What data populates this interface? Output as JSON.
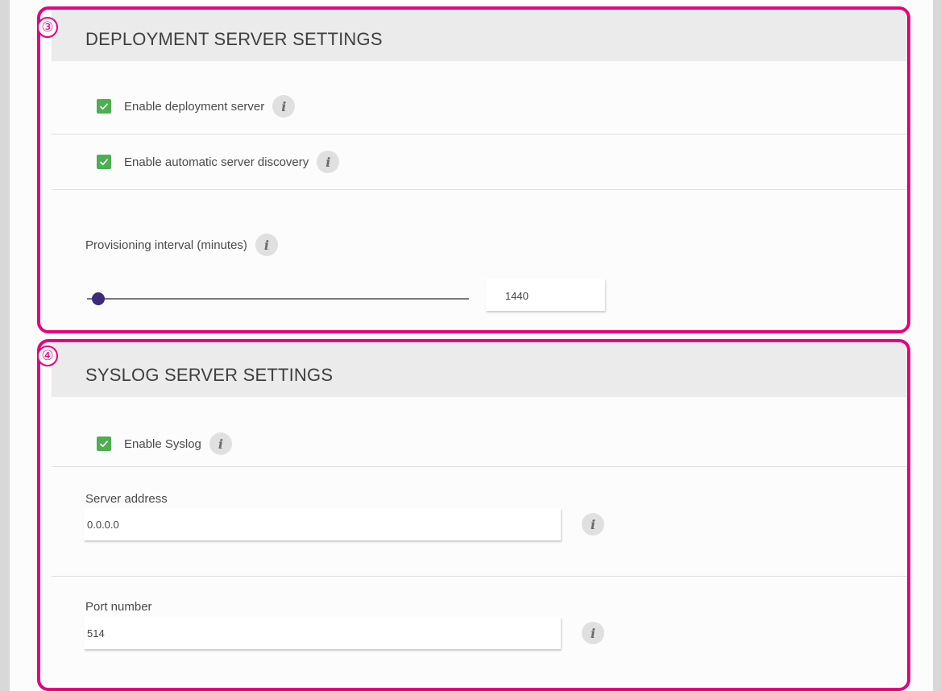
{
  "markers": {
    "deployment": "③",
    "syslog": "④"
  },
  "deployment": {
    "title": "DEPLOYMENT SERVER SETTINGS",
    "enable_server": {
      "label": "Enable deployment server",
      "checked": true
    },
    "auto_discovery": {
      "label": "Enable automatic server discovery",
      "checked": true
    },
    "provisioning": {
      "label": "Provisioning interval (minutes)",
      "value": "1440",
      "slider_fraction": 0.03
    }
  },
  "syslog": {
    "title": "SYSLOG SERVER SETTINGS",
    "enable_syslog": {
      "label": "Enable Syslog",
      "checked": true
    },
    "server_address": {
      "label": "Server address",
      "value": "0.0.0.0"
    },
    "port_number": {
      "label": "Port number",
      "value": "514"
    }
  },
  "icons": {
    "info": "info-icon",
    "checkmark": "checkmark-icon"
  },
  "colors": {
    "highlight": "#e6007e",
    "checkbox": "#4caf50",
    "slider_thumb": "#3d2a7a"
  },
  "info_glyph": "i"
}
